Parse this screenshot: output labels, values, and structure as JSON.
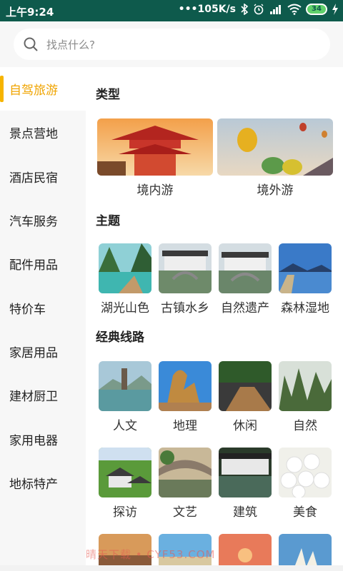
{
  "status_bar": {
    "time": "上午9:24",
    "network_speed": "•••105K/s",
    "battery_level": "34"
  },
  "search": {
    "placeholder": "找点什么?"
  },
  "sidebar": {
    "items": [
      {
        "label": "自驾旅游",
        "active": true
      },
      {
        "label": "景点营地"
      },
      {
        "label": "酒店民宿"
      },
      {
        "label": "汽车服务"
      },
      {
        "label": "配件用品"
      },
      {
        "label": "特价车"
      },
      {
        "label": "家居用品"
      },
      {
        "label": "建材厨卫"
      },
      {
        "label": "家用电器"
      },
      {
        "label": "地标特产"
      }
    ]
  },
  "main": {
    "sections": [
      {
        "title": "类型"
      },
      {
        "title": "主题"
      },
      {
        "title": "经典线路"
      }
    ],
    "type_tiles": [
      {
        "label": "境内游",
        "icon": "pagoda-photo"
      },
      {
        "label": "境外游",
        "icon": "hot-air-balloons-photo"
      }
    ],
    "theme_tiles": [
      {
        "label": "湖光山色",
        "icon": "lake-boat-photo"
      },
      {
        "label": "古镇水乡",
        "icon": "water-town-photo"
      },
      {
        "label": "自然遗产",
        "icon": "water-town-bridge-photo"
      },
      {
        "label": "森林湿地",
        "icon": "boardwalk-lake-photo"
      }
    ],
    "route_tiles_row1": [
      {
        "label": "人文",
        "icon": "pagoda-lake-photo"
      },
      {
        "label": "地理",
        "icon": "rock-formation-photo"
      },
      {
        "label": "休闲",
        "icon": "wooden-pier-photo"
      },
      {
        "label": "自然",
        "icon": "misty-mountains-photo"
      }
    ],
    "route_tiles_row2": [
      {
        "label": "探访",
        "icon": "village-houses-photo"
      },
      {
        "label": "文艺",
        "icon": "stone-bridge-photo"
      },
      {
        "label": "建筑",
        "icon": "canal-town-photo"
      },
      {
        "label": "美食",
        "icon": "steamed-buns-photo"
      }
    ]
  },
  "watermark": "晴天下载 • CYF53.COM"
}
